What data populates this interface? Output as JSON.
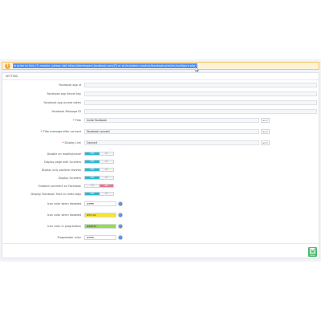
{
  "alert": {
    "text": "In order to fully (?) module, please visit https://developers.facebook.com/(?) or at /en/admin-module/facebook-pixel/en/configure.php (?) you could see the link to configure (?)",
    "icon": "warning-icon"
  },
  "panel": {
    "title": "Setting"
  },
  "fields": {
    "app_id": {
      "label": "Facebook app id"
    },
    "secret_key": {
      "label": "Facebook app Secret key"
    },
    "access_token": {
      "label": "Facebook app access token"
    },
    "pixel_id": {
      "label": "Facebook Message ID"
    },
    "title": {
      "label": "Title",
      "value": "Invite Facebook",
      "lang": "en"
    },
    "title_when_connect": {
      "label": "Title message after connect",
      "value": "Facebook connect",
      "lang": "en"
    },
    "display_link": {
      "label": "Display Link",
      "value": "Connect",
      "lang": "en"
    }
  },
  "toggles": [
    {
      "label": "Disable on mobile/phone",
      "yes": "YES",
      "no": "NO",
      "value": "yes"
    },
    {
      "label": "Display page with Scrollers",
      "yes": "YES",
      "no": "NO",
      "value": "yes"
    },
    {
      "label": "Display only positive reviews",
      "yes": "YES",
      "no": "NO",
      "value": "yes"
    },
    {
      "label": "Display Scrollers",
      "yes": "YES",
      "no": "NO",
      "value": "yes"
    },
    {
      "label": "Enabled comment on Facebook",
      "yes": "YES",
      "no": "NO",
      "value": "no"
    },
    {
      "label": "Display Facebook Time on meta tags",
      "yes": "YES",
      "no": "NO",
      "value": "yes"
    }
  ],
  "colors": [
    {
      "label": "Icon color when disabled",
      "value": "#ffffff",
      "swatch": "#ffffff"
    },
    {
      "label": "Icon color when disabled",
      "value": "#ffcc00",
      "swatch": "#f6e62a"
    },
    {
      "label": "Icon color in progressbar",
      "value": "#66ff33",
      "swatch": "#8fe33c"
    },
    {
      "label": "Progressbar color",
      "value": "#ffffff",
      "swatch": "#ffffff"
    }
  ],
  "save": {
    "label": "Save",
    "icon": "save-icon"
  },
  "colors_accent": {
    "toggle_on": "#25b9d7",
    "toggle_off": "#e8788f",
    "save": "#4cbb6c"
  }
}
